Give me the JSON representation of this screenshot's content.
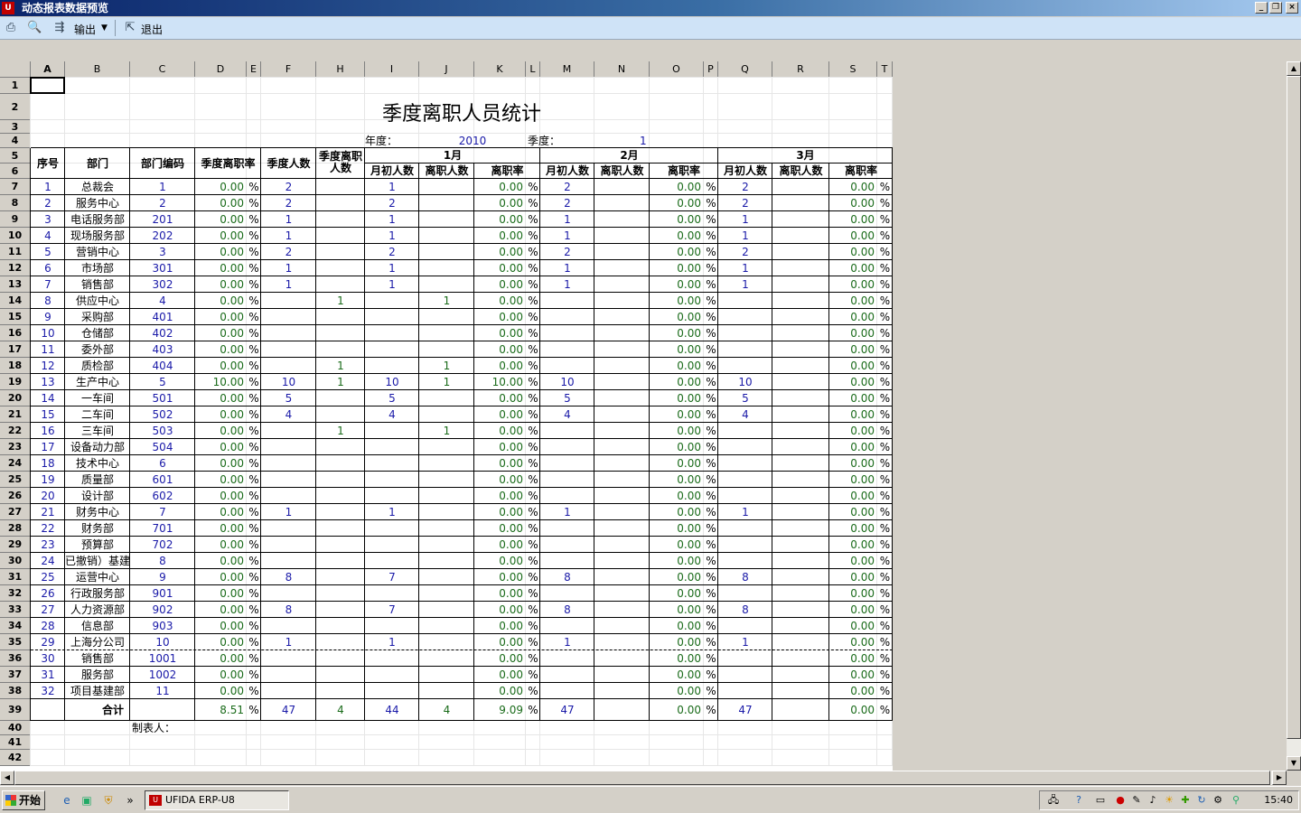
{
  "window": {
    "title": "动态报表数据预览"
  },
  "toolbar": {
    "output_label": "输出",
    "exit_label": "退出"
  },
  "report": {
    "title": "季度离职人员统计",
    "year_label": "年度：",
    "year_value": "2010",
    "quarter_label": "季度：",
    "quarter_value": "1",
    "footer_label": "制表人："
  },
  "columns": [
    "A",
    "B",
    "C",
    "D",
    "E",
    "F",
    "H",
    "I",
    "J",
    "K",
    "L",
    "M",
    "N",
    "O",
    "P",
    "Q",
    "R",
    "S",
    "T"
  ],
  "header": {
    "seq": "序号",
    "dept": "部门",
    "code": "部门编码",
    "q_rate": "季度离职率",
    "q_count": "季度人数",
    "q_left": "季度离职人数",
    "months": [
      "1月",
      "2月",
      "3月"
    ],
    "month_start": "月初人数",
    "month_left": "离职人数",
    "month_rate": "离职率"
  },
  "rows": [
    {
      "n": "1",
      "dept": "总裁会",
      "code": "1",
      "rate": "0.00",
      "qc": "2",
      "ql": "",
      "s1": "1",
      "l1": "",
      "r1": "0.00",
      "s2": "2",
      "l2": "",
      "r2": "0.00",
      "s3": "2",
      "l3": "",
      "r3": "0.00"
    },
    {
      "n": "2",
      "dept": "服务中心",
      "code": "2",
      "rate": "0.00",
      "qc": "2",
      "ql": "",
      "s1": "2",
      "l1": "",
      "r1": "0.00",
      "s2": "2",
      "l2": "",
      "r2": "0.00",
      "s3": "2",
      "l3": "",
      "r3": "0.00"
    },
    {
      "n": "3",
      "dept": "电话服务部",
      "code": "201",
      "rate": "0.00",
      "qc": "1",
      "ql": "",
      "s1": "1",
      "l1": "",
      "r1": "0.00",
      "s2": "1",
      "l2": "",
      "r2": "0.00",
      "s3": "1",
      "l3": "",
      "r3": "0.00"
    },
    {
      "n": "4",
      "dept": "现场服务部",
      "code": "202",
      "rate": "0.00",
      "qc": "1",
      "ql": "",
      "s1": "1",
      "l1": "",
      "r1": "0.00",
      "s2": "1",
      "l2": "",
      "r2": "0.00",
      "s3": "1",
      "l3": "",
      "r3": "0.00"
    },
    {
      "n": "5",
      "dept": "营销中心",
      "code": "3",
      "rate": "0.00",
      "qc": "2",
      "ql": "",
      "s1": "2",
      "l1": "",
      "r1": "0.00",
      "s2": "2",
      "l2": "",
      "r2": "0.00",
      "s3": "2",
      "l3": "",
      "r3": "0.00"
    },
    {
      "n": "6",
      "dept": "市场部",
      "code": "301",
      "rate": "0.00",
      "qc": "1",
      "ql": "",
      "s1": "1",
      "l1": "",
      "r1": "0.00",
      "s2": "1",
      "l2": "",
      "r2": "0.00",
      "s3": "1",
      "l3": "",
      "r3": "0.00"
    },
    {
      "n": "7",
      "dept": "销售部",
      "code": "302",
      "rate": "0.00",
      "qc": "1",
      "ql": "",
      "s1": "1",
      "l1": "",
      "r1": "0.00",
      "s2": "1",
      "l2": "",
      "r2": "0.00",
      "s3": "1",
      "l3": "",
      "r3": "0.00"
    },
    {
      "n": "8",
      "dept": "供应中心",
      "code": "4",
      "rate": "0.00",
      "qc": "",
      "ql": "1",
      "s1": "",
      "l1": "1",
      "r1": "0.00",
      "s2": "",
      "l2": "",
      "r2": "0.00",
      "s3": "",
      "l3": "",
      "r3": "0.00"
    },
    {
      "n": "9",
      "dept": "采购部",
      "code": "401",
      "rate": "0.00",
      "qc": "",
      "ql": "",
      "s1": "",
      "l1": "",
      "r1": "0.00",
      "s2": "",
      "l2": "",
      "r2": "0.00",
      "s3": "",
      "l3": "",
      "r3": "0.00"
    },
    {
      "n": "10",
      "dept": "仓储部",
      "code": "402",
      "rate": "0.00",
      "qc": "",
      "ql": "",
      "s1": "",
      "l1": "",
      "r1": "0.00",
      "s2": "",
      "l2": "",
      "r2": "0.00",
      "s3": "",
      "l3": "",
      "r3": "0.00"
    },
    {
      "n": "11",
      "dept": "委外部",
      "code": "403",
      "rate": "0.00",
      "qc": "",
      "ql": "",
      "s1": "",
      "l1": "",
      "r1": "0.00",
      "s2": "",
      "l2": "",
      "r2": "0.00",
      "s3": "",
      "l3": "",
      "r3": "0.00"
    },
    {
      "n": "12",
      "dept": "质检部",
      "code": "404",
      "rate": "0.00",
      "qc": "",
      "ql": "1",
      "s1": "",
      "l1": "1",
      "r1": "0.00",
      "s2": "",
      "l2": "",
      "r2": "0.00",
      "s3": "",
      "l3": "",
      "r3": "0.00"
    },
    {
      "n": "13",
      "dept": "生产中心",
      "code": "5",
      "rate": "10.00",
      "qc": "10",
      "ql": "1",
      "s1": "10",
      "l1": "1",
      "r1": "10.00",
      "s2": "10",
      "l2": "",
      "r2": "0.00",
      "s3": "10",
      "l3": "",
      "r3": "0.00"
    },
    {
      "n": "14",
      "dept": "一车间",
      "code": "501",
      "rate": "0.00",
      "qc": "5",
      "ql": "",
      "s1": "5",
      "l1": "",
      "r1": "0.00",
      "s2": "5",
      "l2": "",
      "r2": "0.00",
      "s3": "5",
      "l3": "",
      "r3": "0.00"
    },
    {
      "n": "15",
      "dept": "二车间",
      "code": "502",
      "rate": "0.00",
      "qc": "4",
      "ql": "",
      "s1": "4",
      "l1": "",
      "r1": "0.00",
      "s2": "4",
      "l2": "",
      "r2": "0.00",
      "s3": "4",
      "l3": "",
      "r3": "0.00"
    },
    {
      "n": "16",
      "dept": "三车间",
      "code": "503",
      "rate": "0.00",
      "qc": "",
      "ql": "1",
      "s1": "",
      "l1": "1",
      "r1": "0.00",
      "s2": "",
      "l2": "",
      "r2": "0.00",
      "s3": "",
      "l3": "",
      "r3": "0.00"
    },
    {
      "n": "17",
      "dept": "设备动力部",
      "code": "504",
      "rate": "0.00",
      "qc": "",
      "ql": "",
      "s1": "",
      "l1": "",
      "r1": "0.00",
      "s2": "",
      "l2": "",
      "r2": "0.00",
      "s3": "",
      "l3": "",
      "r3": "0.00"
    },
    {
      "n": "18",
      "dept": "技术中心",
      "code": "6",
      "rate": "0.00",
      "qc": "",
      "ql": "",
      "s1": "",
      "l1": "",
      "r1": "0.00",
      "s2": "",
      "l2": "",
      "r2": "0.00",
      "s3": "",
      "l3": "",
      "r3": "0.00"
    },
    {
      "n": "19",
      "dept": "质量部",
      "code": "601",
      "rate": "0.00",
      "qc": "",
      "ql": "",
      "s1": "",
      "l1": "",
      "r1": "0.00",
      "s2": "",
      "l2": "",
      "r2": "0.00",
      "s3": "",
      "l3": "",
      "r3": "0.00"
    },
    {
      "n": "20",
      "dept": "设计部",
      "code": "602",
      "rate": "0.00",
      "qc": "",
      "ql": "",
      "s1": "",
      "l1": "",
      "r1": "0.00",
      "s2": "",
      "l2": "",
      "r2": "0.00",
      "s3": "",
      "l3": "",
      "r3": "0.00"
    },
    {
      "n": "21",
      "dept": "财务中心",
      "code": "7",
      "rate": "0.00",
      "qc": "1",
      "ql": "",
      "s1": "1",
      "l1": "",
      "r1": "0.00",
      "s2": "1",
      "l2": "",
      "r2": "0.00",
      "s3": "1",
      "l3": "",
      "r3": "0.00"
    },
    {
      "n": "22",
      "dept": "财务部",
      "code": "701",
      "rate": "0.00",
      "qc": "",
      "ql": "",
      "s1": "",
      "l1": "",
      "r1": "0.00",
      "s2": "",
      "l2": "",
      "r2": "0.00",
      "s3": "",
      "l3": "",
      "r3": "0.00"
    },
    {
      "n": "23",
      "dept": "预算部",
      "code": "702",
      "rate": "0.00",
      "qc": "",
      "ql": "",
      "s1": "",
      "l1": "",
      "r1": "0.00",
      "s2": "",
      "l2": "",
      "r2": "0.00",
      "s3": "",
      "l3": "",
      "r3": "0.00"
    },
    {
      "n": "24",
      "dept": "已撤销）基建",
      "code": "8",
      "rate": "0.00",
      "qc": "",
      "ql": "",
      "s1": "",
      "l1": "",
      "r1": "0.00",
      "s2": "",
      "l2": "",
      "r2": "0.00",
      "s3": "",
      "l3": "",
      "r3": "0.00"
    },
    {
      "n": "25",
      "dept": "运营中心",
      "code": "9",
      "rate": "0.00",
      "qc": "8",
      "ql": "",
      "s1": "7",
      "l1": "",
      "r1": "0.00",
      "s2": "8",
      "l2": "",
      "r2": "0.00",
      "s3": "8",
      "l3": "",
      "r3": "0.00"
    },
    {
      "n": "26",
      "dept": "行政服务部",
      "code": "901",
      "rate": "0.00",
      "qc": "",
      "ql": "",
      "s1": "",
      "l1": "",
      "r1": "0.00",
      "s2": "",
      "l2": "",
      "r2": "0.00",
      "s3": "",
      "l3": "",
      "r3": "0.00"
    },
    {
      "n": "27",
      "dept": "人力资源部",
      "code": "902",
      "rate": "0.00",
      "qc": "8",
      "ql": "",
      "s1": "7",
      "l1": "",
      "r1": "0.00",
      "s2": "8",
      "l2": "",
      "r2": "0.00",
      "s3": "8",
      "l3": "",
      "r3": "0.00"
    },
    {
      "n": "28",
      "dept": "信息部",
      "code": "903",
      "rate": "0.00",
      "qc": "",
      "ql": "",
      "s1": "",
      "l1": "",
      "r1": "0.00",
      "s2": "",
      "l2": "",
      "r2": "0.00",
      "s3": "",
      "l3": "",
      "r3": "0.00"
    },
    {
      "n": "29",
      "dept": "上海分公司",
      "code": "10",
      "rate": "0.00",
      "qc": "1",
      "ql": "",
      "s1": "1",
      "l1": "",
      "r1": "0.00",
      "s2": "1",
      "l2": "",
      "r2": "0.00",
      "s3": "1",
      "l3": "",
      "r3": "0.00"
    },
    {
      "n": "30",
      "dept": "销售部",
      "code": "1001",
      "rate": "0.00",
      "qc": "",
      "ql": "",
      "s1": "",
      "l1": "",
      "r1": "0.00",
      "s2": "",
      "l2": "",
      "r2": "0.00",
      "s3": "",
      "l3": "",
      "r3": "0.00"
    },
    {
      "n": "31",
      "dept": "服务部",
      "code": "1002",
      "rate": "0.00",
      "qc": "",
      "ql": "",
      "s1": "",
      "l1": "",
      "r1": "0.00",
      "s2": "",
      "l2": "",
      "r2": "0.00",
      "s3": "",
      "l3": "",
      "r3": "0.00"
    },
    {
      "n": "32",
      "dept": "项目基建部",
      "code": "11",
      "rate": "0.00",
      "qc": "",
      "ql": "",
      "s1": "",
      "l1": "",
      "r1": "0.00",
      "s2": "",
      "l2": "",
      "r2": "0.00",
      "s3": "",
      "l3": "",
      "r3": "0.00"
    }
  ],
  "total": {
    "label": "合计",
    "rate": "8.51",
    "qc": "47",
    "ql": "4",
    "s1": "44",
    "l1": "4",
    "r1": "9.09",
    "s2": "47",
    "l2": "",
    "r2": "0.00",
    "s3": "47",
    "l3": "",
    "r3": "0.00"
  },
  "percent_sign": "%",
  "taskbar": {
    "start_label": "开始",
    "task_label": "UFIDA ERP-U8",
    "clock": "15:40"
  }
}
